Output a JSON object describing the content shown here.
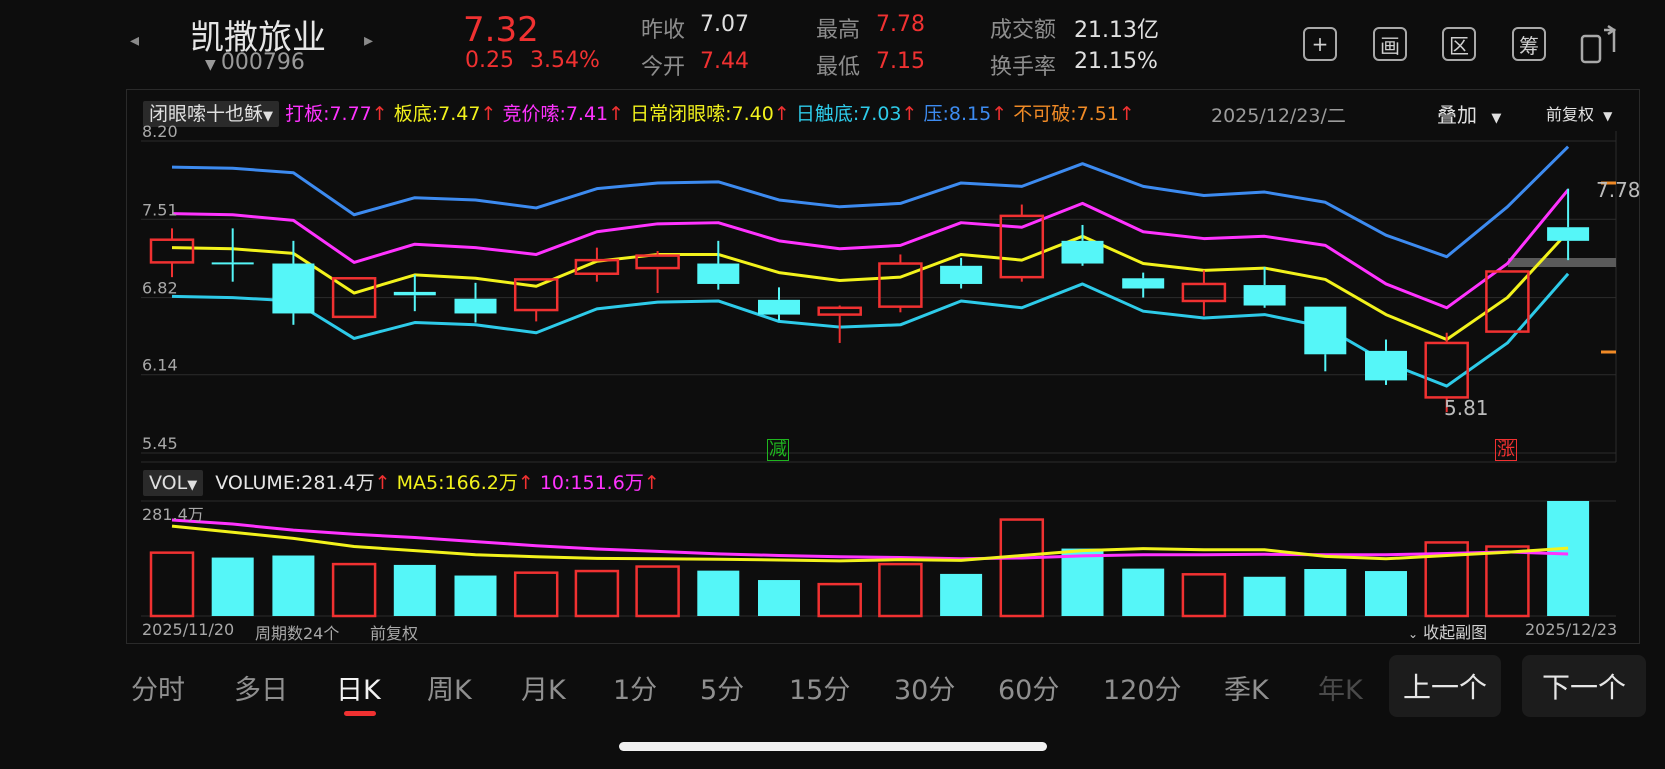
{
  "header": {
    "prev_icon": "chevron-left-icon",
    "next_icon": "chevron-right-icon",
    "stock_name": "凯撒旅业",
    "stock_code": "000796",
    "price": "7.32",
    "change": "0.25",
    "change_pct": "3.54%",
    "quotes": {
      "prev_close_label": "昨收",
      "prev_close": "7.07",
      "open_label": "今开",
      "open": "7.44",
      "high_label": "最高",
      "high": "7.78",
      "low_label": "最低",
      "low": "7.15",
      "turnover_amt_label": "成交额",
      "turnover_amt": "21.13亿",
      "turnover_rate_label": "换手率",
      "turnover_rate": "21.15%"
    },
    "tools": [
      {
        "icon": "plus-icon",
        "glyph": "+"
      },
      {
        "icon": "picture-icon",
        "glyph": "画"
      },
      {
        "icon": "range-icon",
        "glyph": "区"
      },
      {
        "icon": "chips-icon",
        "glyph": "筹"
      },
      {
        "icon": "device-switch-icon",
        "glyph": ""
      }
    ]
  },
  "indicator_bar": {
    "name": "闭眼嗦十也稣",
    "items": [
      {
        "text": "打板:7.77",
        "color": "#ff33ff"
      },
      {
        "text": "板底:7.47",
        "color": "#f2f21c"
      },
      {
        "text": "竞价嗦:7.41",
        "color": "#ff33ff"
      },
      {
        "text": "日常闭眼嗦:7.40",
        "color": "#f2f21c"
      },
      {
        "text": "日触底:7.03",
        "color": "#2ecbe9"
      },
      {
        "text": "压:8.15",
        "color": "#3d8bf0"
      },
      {
        "text": "不可破:7.51",
        "color": "#f08a26"
      }
    ],
    "date": "2025/12/23/二",
    "overlay_label": "叠加",
    "adjust_label": "前复权"
  },
  "main_chart": {
    "y_ticks": [
      "8.20",
      "7.51",
      "6.82",
      "6.14",
      "5.45"
    ],
    "high_label": "7.78",
    "low_label": "5.81",
    "marker_down": "减",
    "marker_up": "涨"
  },
  "volume_bar": {
    "name": "VOL",
    "volume": "VOLUME:281.4万",
    "ma5": "MA5:166.2万",
    "ma10": "10:151.6万",
    "max_label": "281.4万"
  },
  "footer": {
    "start_date": "2025/11/20",
    "period_count": "周期数24个",
    "adjust": "前复权",
    "collapse": "收起副图",
    "end_date": "2025/12/23"
  },
  "timeframes": [
    "分时",
    "多日",
    "日K",
    "周K",
    "月K",
    "1分",
    "5分",
    "15分",
    "30分",
    "60分",
    "120分",
    "季K",
    "年K"
  ],
  "active_timeframe": "日K",
  "prev_button": "上一个",
  "next_button": "下一个",
  "colors": {
    "up": "#f03131",
    "down": "#55f6f8",
    "yellow": "#f2f21c",
    "magenta": "#ff33ff",
    "cyan": "#2ecbe9",
    "blue": "#3d8bf0",
    "orange": "#f08a26"
  },
  "chart_data": {
    "type": "candlestick",
    "y_range": [
      5.45,
      8.2
    ],
    "candles": [
      {
        "o": 7.13,
        "c": 7.33,
        "h": 7.43,
        "l": 7.0,
        "up": true
      },
      {
        "o": 7.13,
        "c": 7.13,
        "h": 7.43,
        "l": 6.96,
        "up": false
      },
      {
        "o": 7.12,
        "c": 6.68,
        "h": 7.32,
        "l": 6.58,
        "up": false
      },
      {
        "o": 6.65,
        "c": 6.99,
        "h": 6.99,
        "l": 6.65,
        "up": true
      },
      {
        "o": 6.87,
        "c": 6.84,
        "h": 7.02,
        "l": 6.7,
        "up": false
      },
      {
        "o": 6.81,
        "c": 6.68,
        "h": 6.95,
        "l": 6.6,
        "up": false
      },
      {
        "o": 6.71,
        "c": 6.98,
        "h": 6.98,
        "l": 6.61,
        "up": true
      },
      {
        "o": 7.03,
        "c": 7.15,
        "h": 7.26,
        "l": 6.96,
        "up": true
      },
      {
        "o": 7.08,
        "c": 7.19,
        "h": 7.23,
        "l": 6.86,
        "up": true
      },
      {
        "o": 7.12,
        "c": 6.94,
        "h": 7.32,
        "l": 6.89,
        "up": false
      },
      {
        "o": 6.8,
        "c": 6.67,
        "h": 6.91,
        "l": 6.62,
        "up": false
      },
      {
        "o": 6.67,
        "c": 6.73,
        "h": 6.75,
        "l": 6.42,
        "up": true
      },
      {
        "o": 6.74,
        "c": 7.12,
        "h": 7.2,
        "l": 6.69,
        "up": true
      },
      {
        "o": 7.1,
        "c": 6.94,
        "h": 7.17,
        "l": 6.9,
        "up": false
      },
      {
        "o": 7.0,
        "c": 7.54,
        "h": 7.64,
        "l": 6.96,
        "up": true
      },
      {
        "o": 7.32,
        "c": 7.12,
        "h": 7.46,
        "l": 7.1,
        "up": false
      },
      {
        "o": 6.99,
        "c": 6.9,
        "h": 7.04,
        "l": 6.82,
        "up": false
      },
      {
        "o": 6.79,
        "c": 6.94,
        "h": 7.06,
        "l": 6.66,
        "up": true
      },
      {
        "o": 6.93,
        "c": 6.75,
        "h": 7.09,
        "l": 6.73,
        "up": false
      },
      {
        "o": 6.74,
        "c": 6.32,
        "h": 6.74,
        "l": 6.17,
        "up": false
      },
      {
        "o": 6.35,
        "c": 6.09,
        "h": 6.45,
        "l": 6.05,
        "up": false
      },
      {
        "o": 5.94,
        "c": 6.42,
        "h": 6.51,
        "l": 5.81,
        "up": true
      },
      {
        "o": 6.52,
        "c": 7.05,
        "h": 7.05,
        "l": 6.52,
        "up": true
      },
      {
        "o": 7.44,
        "c": 7.32,
        "h": 7.78,
        "l": 7.15,
        "up": false
      }
    ],
    "lines": [
      {
        "name": "压",
        "color": "#3d8bf0",
        "values": [
          7.97,
          7.96,
          7.92,
          7.55,
          7.7,
          7.68,
          7.61,
          7.78,
          7.83,
          7.84,
          7.68,
          7.62,
          7.65,
          7.83,
          7.8,
          8.0,
          7.8,
          7.72,
          7.75,
          7.66,
          7.37,
          7.18,
          7.62,
          8.15
        ]
      },
      {
        "name": "打板",
        "color": "#ff33ff",
        "values": [
          7.56,
          7.55,
          7.5,
          7.13,
          7.29,
          7.26,
          7.2,
          7.4,
          7.47,
          7.48,
          7.32,
          7.25,
          7.28,
          7.48,
          7.44,
          7.65,
          7.4,
          7.34,
          7.36,
          7.28,
          6.94,
          6.73,
          7.12,
          7.77
        ]
      },
      {
        "name": "日常闭眼嗦",
        "color": "#f2f21c",
        "values": [
          7.26,
          7.25,
          7.21,
          6.86,
          7.02,
          6.99,
          6.92,
          7.14,
          7.2,
          7.2,
          7.04,
          6.97,
          7.0,
          7.2,
          7.15,
          7.36,
          7.12,
          7.06,
          7.08,
          6.98,
          6.67,
          6.45,
          6.82,
          7.4
        ]
      },
      {
        "name": "日触底",
        "color": "#2ecbe9",
        "values": [
          6.83,
          6.82,
          6.79,
          6.46,
          6.6,
          6.58,
          6.51,
          6.72,
          6.78,
          6.79,
          6.61,
          6.56,
          6.58,
          6.79,
          6.73,
          6.94,
          6.7,
          6.64,
          6.67,
          6.56,
          6.25,
          6.04,
          6.42,
          7.03
        ]
      }
    ],
    "volume": {
      "max": 281.4,
      "values": [
        155,
        143,
        148,
        127,
        125,
        99,
        106,
        110,
        121,
        111,
        88,
        78,
        127,
        103,
        236,
        165,
        116,
        102,
        96,
        115,
        110,
        180,
        170,
        281.4
      ],
      "ma5": [
        220,
        205,
        190,
        170,
        160,
        150,
        145,
        141,
        140,
        139,
        137,
        135,
        138,
        136,
        148,
        160,
        165,
        162,
        162,
        146,
        140,
        148,
        156,
        166.2
      ],
      "ma10": [
        235,
        225,
        210,
        200,
        192,
        182,
        172,
        164,
        158,
        152,
        148,
        145,
        143,
        140,
        142,
        147,
        150,
        150,
        151,
        150,
        150,
        153,
        157,
        151.6
      ]
    }
  }
}
